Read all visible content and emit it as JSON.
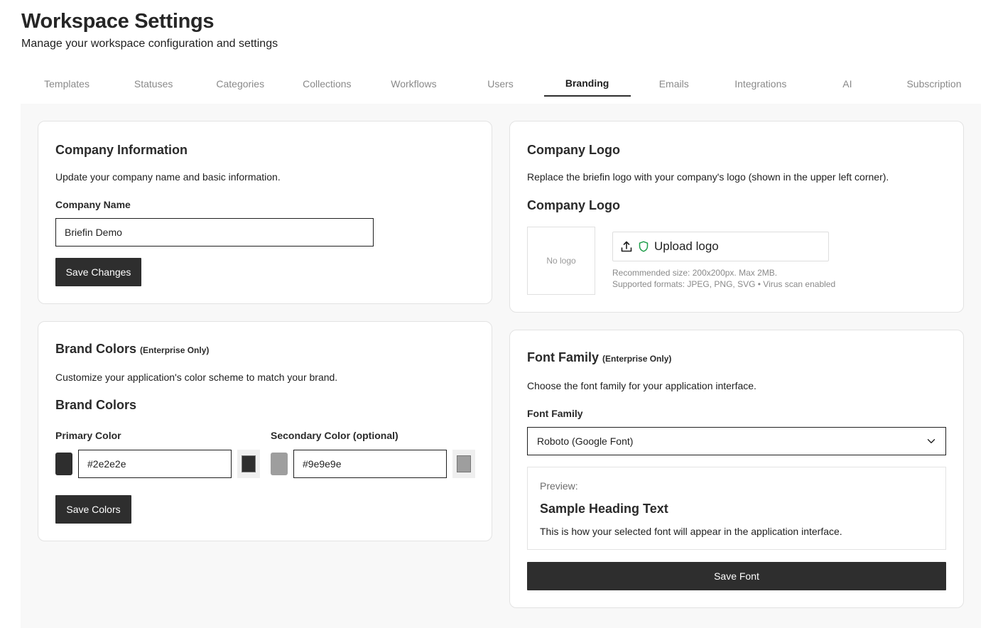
{
  "header": {
    "title": "Workspace Settings",
    "subtitle": "Manage your workspace configuration and settings"
  },
  "tabs": [
    {
      "label": "Templates",
      "active": false
    },
    {
      "label": "Statuses",
      "active": false
    },
    {
      "label": "Categories",
      "active": false
    },
    {
      "label": "Collections",
      "active": false
    },
    {
      "label": "Workflows",
      "active": false
    },
    {
      "label": "Users",
      "active": false
    },
    {
      "label": "Branding",
      "active": true
    },
    {
      "label": "Emails",
      "active": false
    },
    {
      "label": "Integrations",
      "active": false
    },
    {
      "label": "AI",
      "active": false
    },
    {
      "label": "Subscription",
      "active": false
    }
  ],
  "company_info": {
    "title": "Company Information",
    "description": "Update your company name and basic information.",
    "name_label": "Company Name",
    "name_value": "Briefin Demo",
    "save_label": "Save Changes"
  },
  "brand_colors": {
    "title": "Brand Colors",
    "badge": "(Enterprise Only)",
    "description": "Customize your application's color scheme to match your brand.",
    "sub_heading": "Brand Colors",
    "primary_label": "Primary Color",
    "primary_value": "#2e2e2e",
    "secondary_label": "Secondary Color (optional)",
    "secondary_value": "#9e9e9e",
    "save_label": "Save Colors"
  },
  "company_logo": {
    "title": "Company Logo",
    "description": "Replace the briefin logo with your company's logo (shown in the upper left corner).",
    "sub_heading": "Company Logo",
    "placeholder": "No logo",
    "upload_label": "Upload logo",
    "hint_size": "Recommended size: 200x200px. Max 2MB.",
    "hint_formats": "Supported formats: JPEG, PNG, SVG • Virus scan enabled",
    "upload_icon": "upload-icon",
    "shield_icon": "shield-icon",
    "shield_color": "#1e9e4a"
  },
  "font_family": {
    "title": "Font Family",
    "badge": "(Enterprise Only)",
    "description": "Choose the font family for your application interface.",
    "label": "Font Family",
    "selected": "Roboto (Google Font)",
    "preview_label": "Preview:",
    "preview_heading": "Sample Heading Text",
    "preview_body": "This is how your selected font will appear in the application interface.",
    "save_label": "Save Font"
  }
}
